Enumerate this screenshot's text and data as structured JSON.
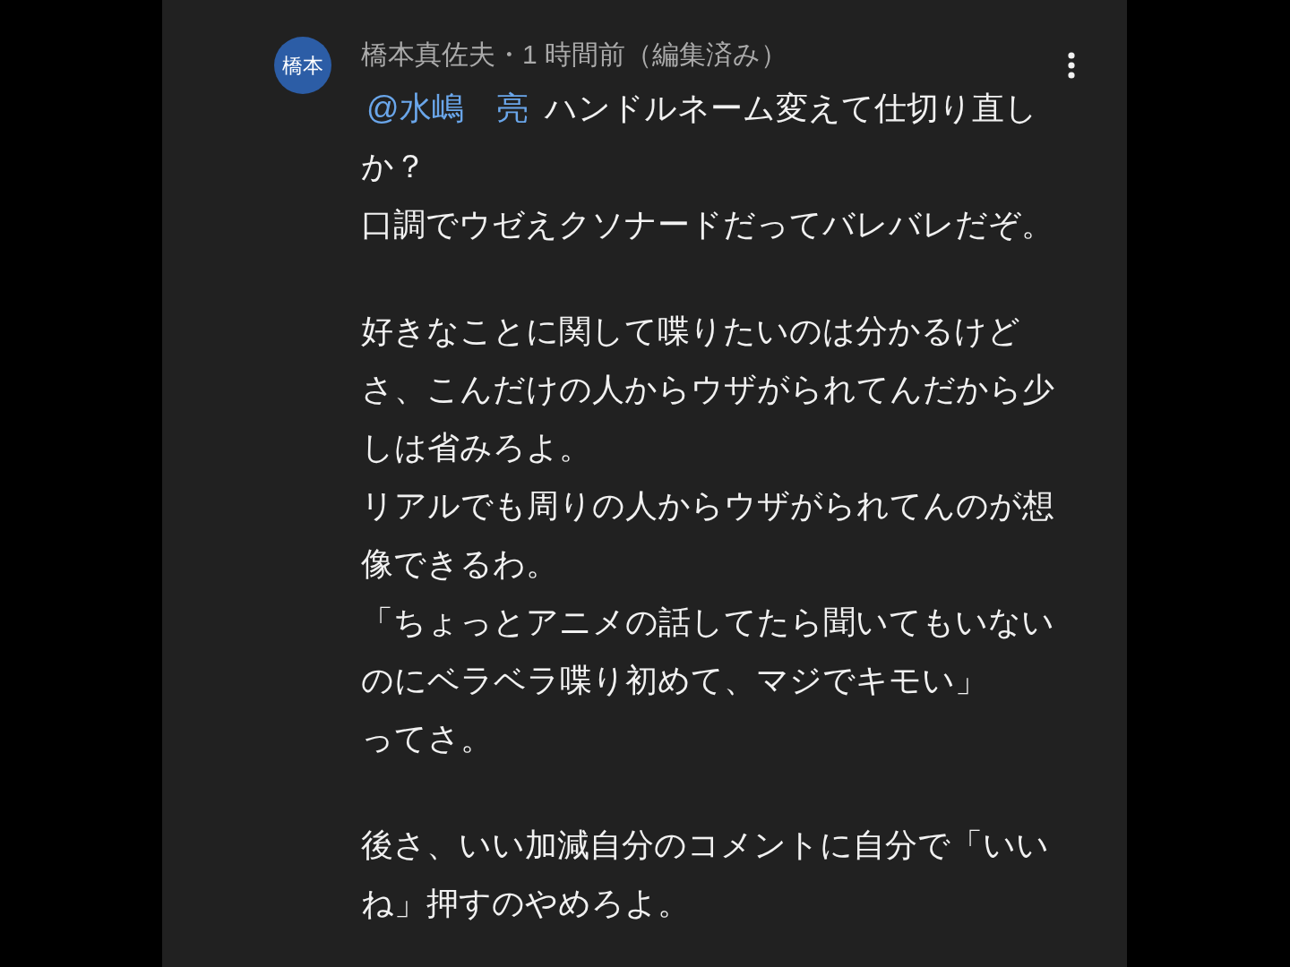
{
  "comment": {
    "avatar": {
      "initials": "橋本"
    },
    "byline": "橋本真佐夫・1 時間前（編集済み）",
    "paragraphs": [
      {
        "lines": [
          {
            "mention": "@水嶋　亮",
            "text": "ハンドルネーム変えて仕切り直しか？"
          },
          {
            "text": "口調でウゼえクソナードだってバレバレだぞ。"
          }
        ]
      },
      {
        "lines": [
          {
            "text": "好きなことに関して喋りたいのは分かるけどさ、こんだけの人からウザがられてんだから少しは省みろよ。"
          },
          {
            "text": "リアルでも周りの人からウザがられてんのが想像できるわ。"
          },
          {
            "text": "「ちょっとアニメの話してたら聞いてもいないのにベラベラ喋り初めて、マジでキモい」"
          },
          {
            "text": "ってさ。"
          }
        ]
      },
      {
        "lines": [
          {
            "text": "後さ、いい加減自分のコメントに自分で「いいね」押すのやめろよ。"
          }
        ]
      }
    ]
  }
}
